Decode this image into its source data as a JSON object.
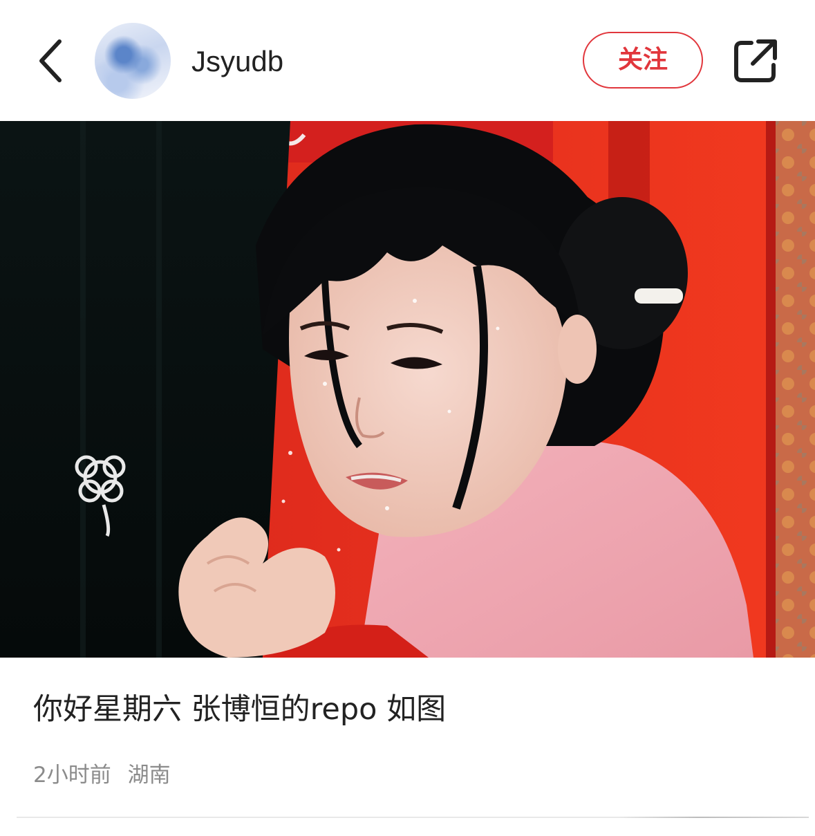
{
  "header": {
    "back_icon": "chevron-left-icon",
    "username": "Jsyudb",
    "follow_label": "关注",
    "share_icon": "share-external-icon",
    "accent_color": "#e1363c"
  },
  "post": {
    "media_type": "image",
    "caption": "你好星期六 张博恒的repo 如图",
    "time": "2小时前",
    "location": "湖南"
  }
}
